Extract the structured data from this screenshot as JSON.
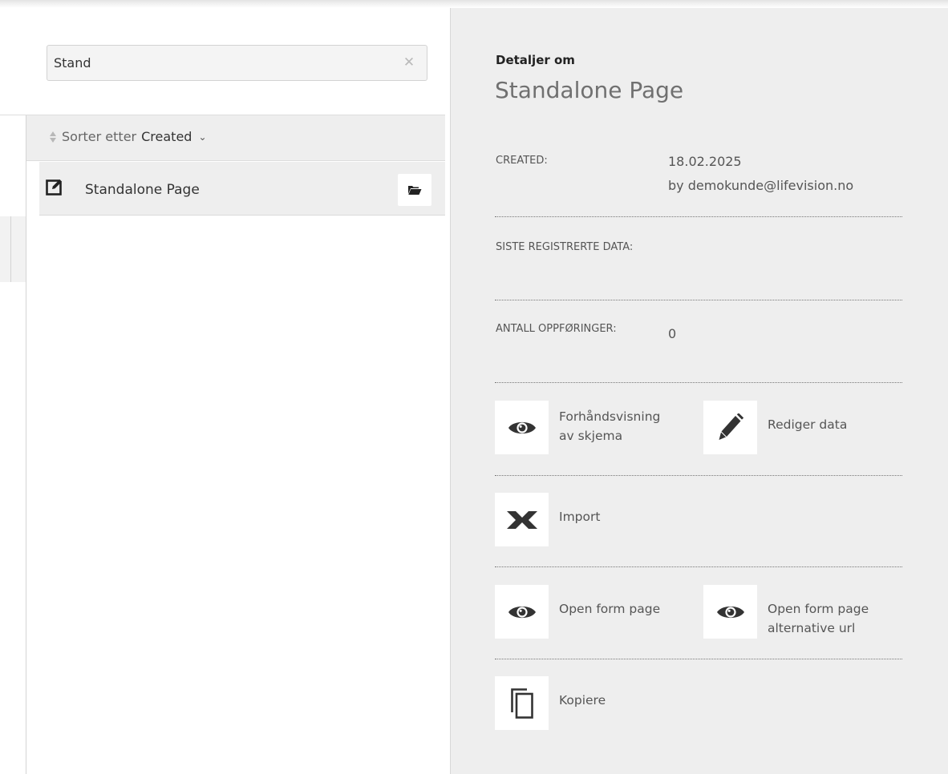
{
  "search": {
    "value": "Stand",
    "clear_symbol": "✕"
  },
  "sort": {
    "prefix": "Sorter etter",
    "key": "Created",
    "chevron": "⌄"
  },
  "list": {
    "items": [
      {
        "label": "Standalone Page",
        "icon": "edit-icon",
        "action_icon": "folder-open-icon"
      }
    ]
  },
  "details": {
    "kicker": "Detaljer om",
    "title": "Standalone Page",
    "fields": [
      {
        "label": "CREATED:",
        "value_line1": "18.02.2025",
        "value_line2": "by demokunde@lifevision.no"
      },
      {
        "label": "SISTE REGISTRERTE DATA:",
        "value_line1": "",
        "value_line2": ""
      },
      {
        "label": "ANTALL OPPFØRINGER:",
        "value_line1": "0",
        "value_line2": ""
      }
    ]
  },
  "actions": [
    {
      "label_line1": "Forhåndsvisning",
      "label_line2": "av skjema",
      "icon": "eye-icon"
    },
    {
      "label_line1": "Rediger data",
      "label_line2": "",
      "icon": "pencil-icon"
    },
    {
      "label_line1": "Import",
      "label_line2": "",
      "icon": "excel-icon"
    },
    {
      "label_line1": "Open form page",
      "label_line2": "",
      "icon": "eye-icon"
    },
    {
      "label_line1": "Open form page",
      "label_line2": "alternative url",
      "icon": "eye-icon"
    },
    {
      "label_line1": "Kopiere",
      "label_line2": "",
      "icon": "copy-icon"
    }
  ],
  "colors": {
    "panel_bg": "#eeeeee",
    "icon_dark": "#333333",
    "text_muted": "#555555"
  }
}
